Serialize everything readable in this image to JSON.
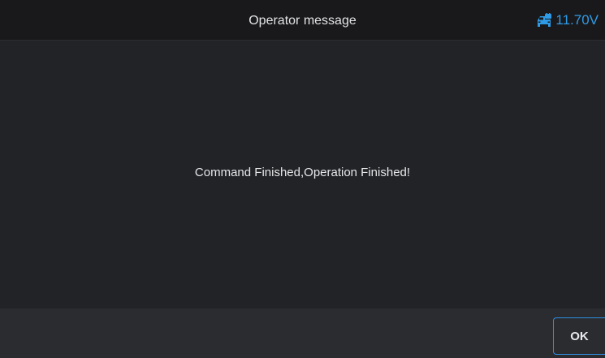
{
  "header": {
    "title": "Operator message",
    "voltage": "11.70V",
    "voltage_icon": "car-battery-icon",
    "accent_color": "#2f9be6"
  },
  "main": {
    "message": "Command Finished,Operation Finished!"
  },
  "footer": {
    "ok_label": "OK"
  }
}
